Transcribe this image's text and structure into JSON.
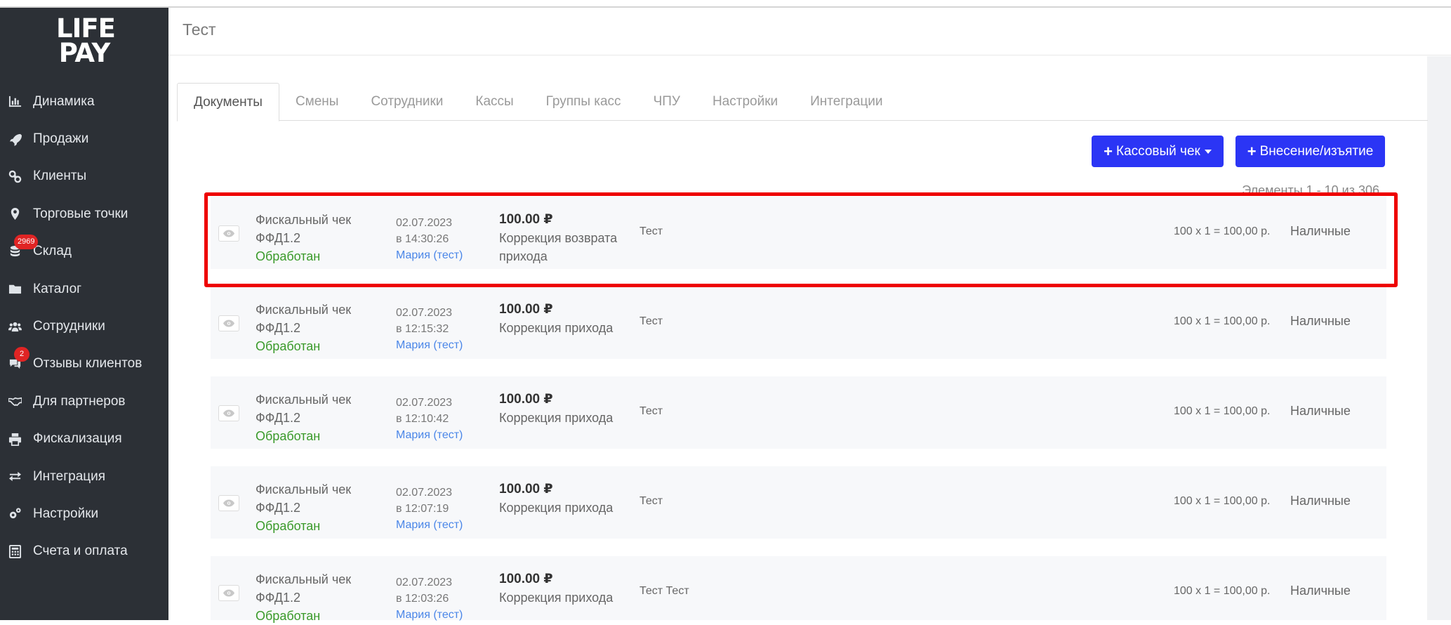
{
  "app": {
    "logo_line1": "LIFE",
    "logo_line2": "PAY"
  },
  "sidebar": {
    "items": [
      {
        "label": "Динамика",
        "icon": "bar-chart-icon"
      },
      {
        "label": "Продажи",
        "icon": "rocket-icon"
      },
      {
        "label": "Клиенты",
        "icon": "link-icon"
      },
      {
        "label": "Торговые точки",
        "icon": "map-marker-icon"
      },
      {
        "label": "Склад",
        "icon": "database-icon",
        "badge": "2969"
      },
      {
        "label": "Каталог",
        "icon": "folder-icon"
      },
      {
        "label": "Сотрудники",
        "icon": "users-icon"
      },
      {
        "label": "Отзывы клиентов",
        "icon": "comments-icon",
        "badge": "2"
      },
      {
        "label": "Для партнеров",
        "icon": "handshake-icon"
      },
      {
        "label": "Фискализация",
        "icon": "printer-icon"
      },
      {
        "label": "Интеграция",
        "icon": "exchange-icon"
      },
      {
        "label": "Настройки",
        "icon": "gears-icon"
      },
      {
        "label": "Счета и оплата",
        "icon": "calculator-icon"
      }
    ]
  },
  "header": {
    "title": "Тест"
  },
  "tabs": [
    {
      "label": "Документы",
      "active": true
    },
    {
      "label": "Смены"
    },
    {
      "label": "Сотрудники"
    },
    {
      "label": "Кассы"
    },
    {
      "label": "Группы касс"
    },
    {
      "label": "ЧПУ"
    },
    {
      "label": "Настройки"
    },
    {
      "label": "Интеграции"
    }
  ],
  "actions": {
    "cash_receipt_label": "Кассовый чек",
    "deposit_label": "Внесение/изъятие"
  },
  "pager": {
    "info": "Элементы 1 - 10 из 306."
  },
  "documents": [
    {
      "type_line1": "Фискальный чек",
      "type_line2": "ФФД1.2",
      "status": "Обработан",
      "date": "02.07.2023",
      "time": "в 14:30:26",
      "user": "Мария (тест)",
      "amount": "100.00 ₽",
      "operation_line1": "Коррекция возврата",
      "operation_line2": "прихода",
      "comment": "Тест",
      "calc": "100 x 1 =   100,00 р.",
      "payment": "Наличные"
    },
    {
      "type_line1": "Фискальный чек",
      "type_line2": "ФФД1.2",
      "status": "Обработан",
      "date": "02.07.2023",
      "time": "в 12:15:32",
      "user": "Мария (тест)",
      "amount": "100.00 ₽",
      "operation_line1": "Коррекция прихода",
      "operation_line2": "",
      "comment": "Тест",
      "calc": "100 x 1 =   100,00 р.",
      "payment": "Наличные"
    },
    {
      "type_line1": "Фискальный чек",
      "type_line2": "ФФД1.2",
      "status": "Обработан",
      "date": "02.07.2023",
      "time": "в 12:10:42",
      "user": "Мария (тест)",
      "amount": "100.00 ₽",
      "operation_line1": "Коррекция прихода",
      "operation_line2": "",
      "comment": "Тест",
      "calc": "100 x 1 =   100,00 р.",
      "payment": "Наличные"
    },
    {
      "type_line1": "Фискальный чек",
      "type_line2": "ФФД1.2",
      "status": "Обработан",
      "date": "02.07.2023",
      "time": "в 12:07:19",
      "user": "Мария (тест)",
      "amount": "100.00 ₽",
      "operation_line1": "Коррекция прихода",
      "operation_line2": "",
      "comment": "Тест",
      "calc": "100 x 1 =   100,00 р.",
      "payment": "Наличные"
    },
    {
      "type_line1": "Фискальный чек",
      "type_line2": "ФФД1.2",
      "status": "Обработан",
      "date": "02.07.2023",
      "time": "в 12:03:26",
      "user": "Мария (тест)",
      "amount": "100.00 ₽",
      "operation_line1": "Коррекция прихода",
      "operation_line2": "",
      "comment": "Тест Тест",
      "calc": "100 x 1 =   100,00 р.",
      "payment": "Наличные"
    }
  ]
}
